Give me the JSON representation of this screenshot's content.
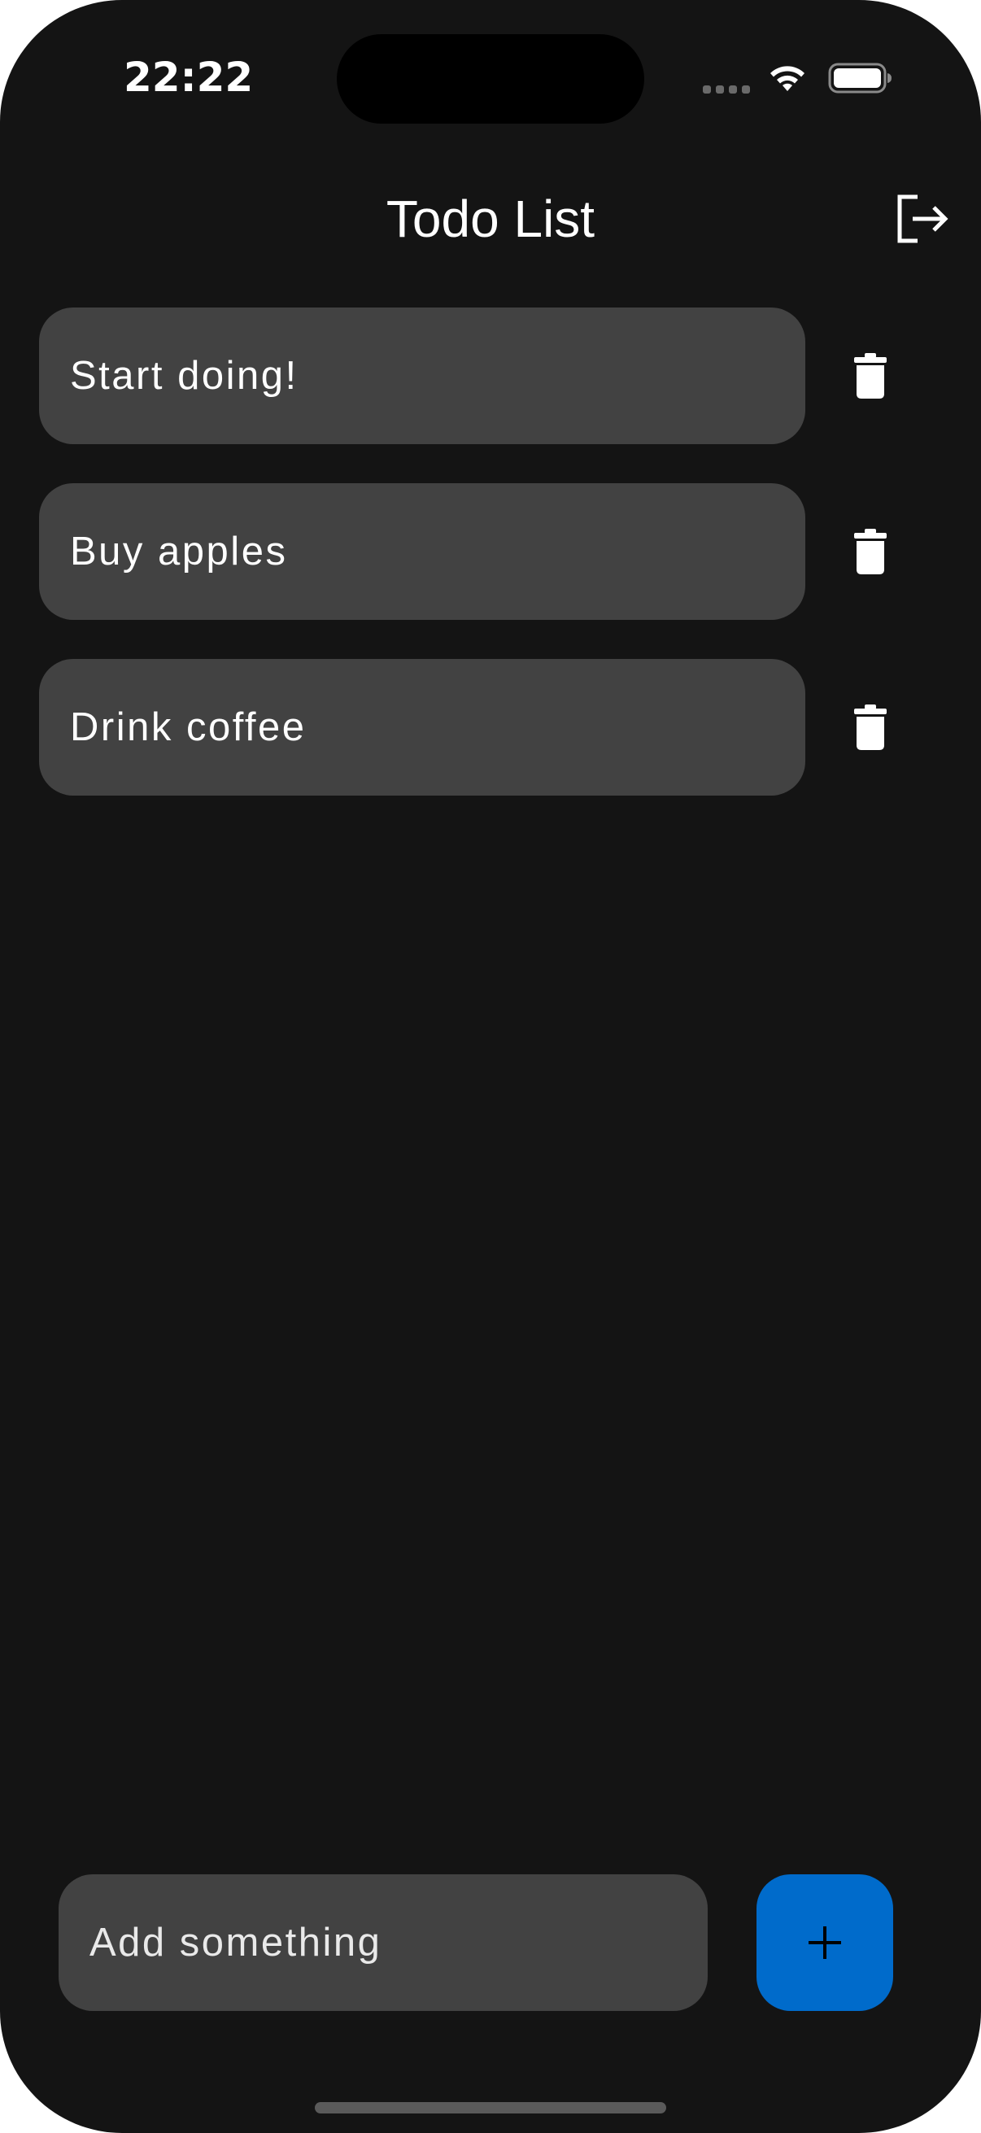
{
  "status_bar": {
    "time": "22:22"
  },
  "header": {
    "title": "Todo List",
    "logout_icon": "logout-icon"
  },
  "todos": [
    {
      "text": "Start doing!"
    },
    {
      "text": "Buy apples"
    },
    {
      "text": "Drink coffee"
    }
  ],
  "composer": {
    "placeholder": "Add something",
    "value": "",
    "add_icon": "plus-icon"
  },
  "colors": {
    "background": "#141414",
    "card": "#424242",
    "accent": "#006bcb",
    "text": "#ffffff"
  }
}
